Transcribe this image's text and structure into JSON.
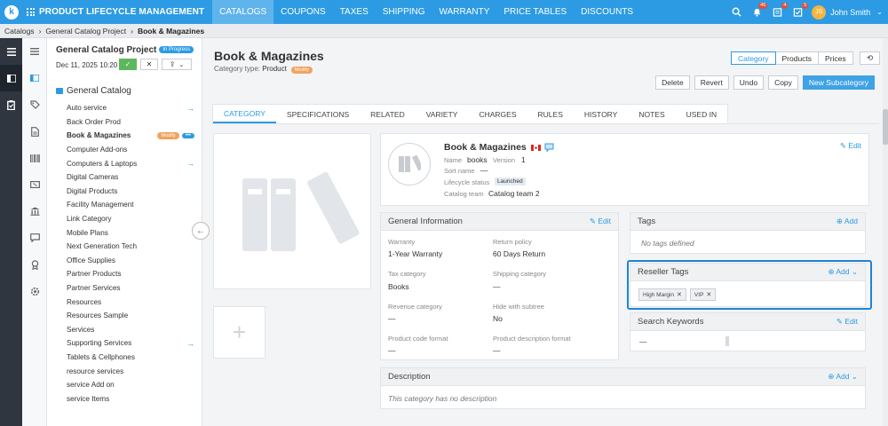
{
  "topbar": {
    "logo": "k",
    "app_title": "PRODUCT LIFECYCLE MANAGEMENT",
    "nav": [
      "CATALOGS",
      "COUPONS",
      "TAXES",
      "SHIPPING",
      "WARRANTY",
      "PRICE TABLES",
      "DISCOUNTS"
    ],
    "active_nav": "CATALOGS",
    "notif_count": "46",
    "task_count": "4",
    "check_count": "5",
    "avatar_initials": "JS",
    "user_name": "John Smith"
  },
  "breadcrumb": [
    "Catalogs",
    "General Catalog Project",
    "Book & Magazines"
  ],
  "project": {
    "title": "General Catalog Project",
    "status": "In Progress",
    "date": "Dec 11, 2025 10:20"
  },
  "tree": {
    "root": "General Catalog",
    "items": [
      {
        "label": "Auto service",
        "expand": true
      },
      {
        "label": "Back Order Prod"
      },
      {
        "label": "Book & Magazines",
        "selected": true,
        "badge": "Modify"
      },
      {
        "label": "Computer Add-ons"
      },
      {
        "label": "Computers & Laptops",
        "expand": true
      },
      {
        "label": "Digital Cameras"
      },
      {
        "label": "Digital Products"
      },
      {
        "label": "Facility Management"
      },
      {
        "label": "Link Category"
      },
      {
        "label": "Mobile Plans"
      },
      {
        "label": "Next Generation Tech"
      },
      {
        "label": "Office Supplies"
      },
      {
        "label": "Partner Products"
      },
      {
        "label": "Partner Services"
      },
      {
        "label": "Resources"
      },
      {
        "label": "Resources Sample"
      },
      {
        "label": "Services"
      },
      {
        "label": "Supporting Services",
        "expand": true
      },
      {
        "label": "Tablets & Cellphones"
      },
      {
        "label": "resource services"
      },
      {
        "label": "service Add on"
      },
      {
        "label": "service Items"
      }
    ]
  },
  "header": {
    "title": "Book & Magazines",
    "type_label": "Category type:",
    "type_value": "Product",
    "type_badge": "Modify"
  },
  "view_switch": [
    "Category",
    "Products",
    "Prices"
  ],
  "actions": [
    "Delete",
    "Revert",
    "Undo",
    "Copy",
    "New Subcategory"
  ],
  "tabs": [
    "CATEGORY",
    "SPECIFICATIONS",
    "RELATED",
    "VARIETY",
    "CHARGES",
    "RULES",
    "HISTORY",
    "NOTES",
    "USED IN"
  ],
  "summary": {
    "name": "Book & Magazines",
    "edit": "Edit",
    "name_label": "Name",
    "name_value": "books",
    "version_label": "Version",
    "version_value": "1",
    "short_label": "Sort name",
    "short_value": "—",
    "lifecycle_label": "Lifecycle status",
    "lifecycle_value": "Launched",
    "team_label": "Catalog team",
    "team_value": "Catalog team 2"
  },
  "general": {
    "title": "General Information",
    "edit": "Edit",
    "fields": [
      {
        "label": "Warranty",
        "value": "1-Year Warranty"
      },
      {
        "label": "Return policy",
        "value": "60 Days Return"
      },
      {
        "label": "Tax category",
        "value": "Books"
      },
      {
        "label": "Shipping category",
        "value": "—"
      },
      {
        "label": "Revenue category",
        "value": "—"
      },
      {
        "label": "Hide with subtree",
        "value": "No"
      },
      {
        "label": "Product code format",
        "value": "—"
      },
      {
        "label": "Product description format",
        "value": "—"
      }
    ]
  },
  "tags": {
    "title": "Tags",
    "add": "Add",
    "empty": "No tags defined"
  },
  "reseller": {
    "title": "Reseller Tags",
    "add": "Add",
    "chips": [
      "High Margin",
      "VIP"
    ]
  },
  "keywords": {
    "title": "Search Keywords",
    "edit": "Edit",
    "value": "—"
  },
  "description": {
    "title": "Description",
    "add": "Add",
    "empty": "This category has no description"
  },
  "colors": {
    "brand": "#2c9be3",
    "highlight": "#1f84d6",
    "modify_badge": "#f0a35e"
  }
}
